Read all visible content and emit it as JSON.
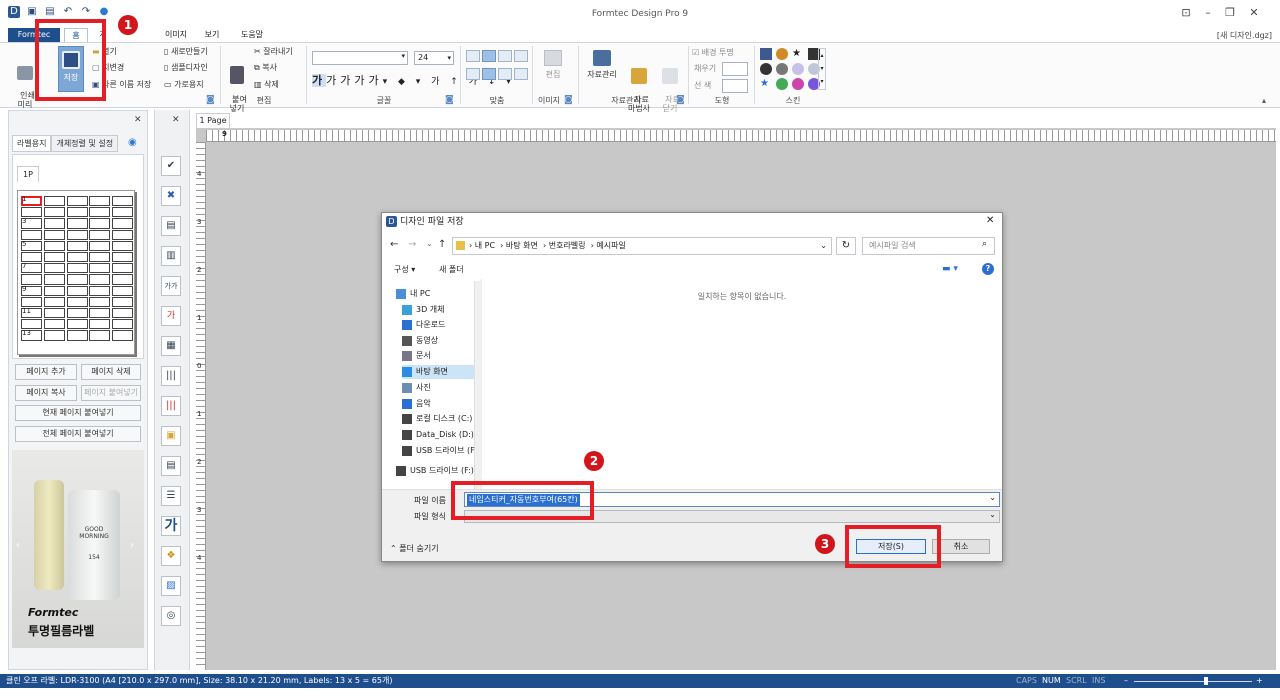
{
  "app": {
    "title": "Formtec Design Pro 9",
    "doc_name": "[새 디자인.dgz]",
    "tabs": [
      "Formtec",
      "홈",
      "개",
      "이미지",
      "보기",
      "도움말"
    ]
  },
  "ribbon": {
    "print_label": "인쇄\n미리",
    "save_label": "저장",
    "open_label": "열기",
    "export_label": "내보내기",
    "change_label": "지변경",
    "saveas_label": "다른 이름 저장",
    "new_label": "새로만들기",
    "sample_label": "샘플디자인",
    "horizontal_label": "가로용지",
    "paste_label": "붙여\n넣기",
    "cut_label": "잘라내기",
    "copy_label": "복사",
    "delete_label": "삭제",
    "edit_group": "편집",
    "font_group": "글꼴",
    "font_size": "24",
    "align_group": "맞춤",
    "image_group": "이미지",
    "image_edit": "편집",
    "resource_group": "자료관리",
    "resource_mgr": "자료관리",
    "resource_wizard": "자료\n마법사",
    "resource_close": "자료\n닫기",
    "shape_group": "도형",
    "bg_transparent": "배경 투명",
    "fill_label": "채우기",
    "line_color": "선 색",
    "skin_group": "스킨"
  },
  "left_panel": {
    "tabs": [
      "라벨용지",
      "개체정렬 및 설정"
    ],
    "page_tab": "1P",
    "row_numbers": [
      "1",
      "3",
      "5",
      "7",
      "9",
      "11",
      "13"
    ],
    "buttons": {
      "add_page": "페이지 추가",
      "delete_page": "페이지 삭제",
      "copy_page": "페이지 복사",
      "paste_page": "페이지 붙여넣기",
      "paste_current": "현재 페이지 붙여넣기",
      "paste_all": "전체 페이지 붙여넣기"
    },
    "promo": {
      "brand": "Formtec",
      "caption": "투명필름라벨",
      "bottle_text1": "GOOD",
      "bottle_text2": "MORNING",
      "bottle_text3": "154"
    }
  },
  "canvas": {
    "page_tab": "1 Page",
    "vruler_labels": [
      "4",
      "3",
      "2",
      "1",
      "0",
      "1",
      "2",
      "3",
      "4"
    ],
    "hruler_start": "9"
  },
  "dialog": {
    "title": "디자인 파일 저장",
    "breadcrumb": [
      "내 PC",
      "바탕 화면",
      "번호라벨링",
      "예시파일"
    ],
    "search_placeholder": "예시파일 검색",
    "organize": "구성 ▾",
    "new_folder": "새 폴더",
    "empty_message": "일치하는 항목이 없습니다.",
    "nav_items": [
      "내 PC",
      "3D 개체",
      "다운로드",
      "동영상",
      "문서",
      "바탕 화면",
      "사진",
      "음악",
      "로컬 디스크 (C:)",
      "Data_Disk (D:)",
      "USB 드라이브 (F",
      "USB 드라이브 (F:)"
    ],
    "filename_label": "파일 이름",
    "filename_value": "네임스티커_자동번호부여(65칸)",
    "filetype_label": "파일 형식",
    "hide_folders": "폴더 숨기기",
    "save_button": "저장(S)",
    "cancel_button": "취소"
  },
  "badges": [
    "1",
    "2",
    "3"
  ],
  "status": {
    "text": "클린 오프 라벨: LDR-3100 (A4 [210.0 x 297.0 mm], Size: 38.10 x 21.20 mm,  Labels: 13 x 5 = 65개)",
    "caps": "CAPS",
    "num": "NUM",
    "scrl": "SCRL",
    "ins": "INS"
  },
  "colors": {
    "brand_blue": "#1e4f8c",
    "highlight_red": "#e31e24",
    "badge_red": "#d1151b"
  }
}
